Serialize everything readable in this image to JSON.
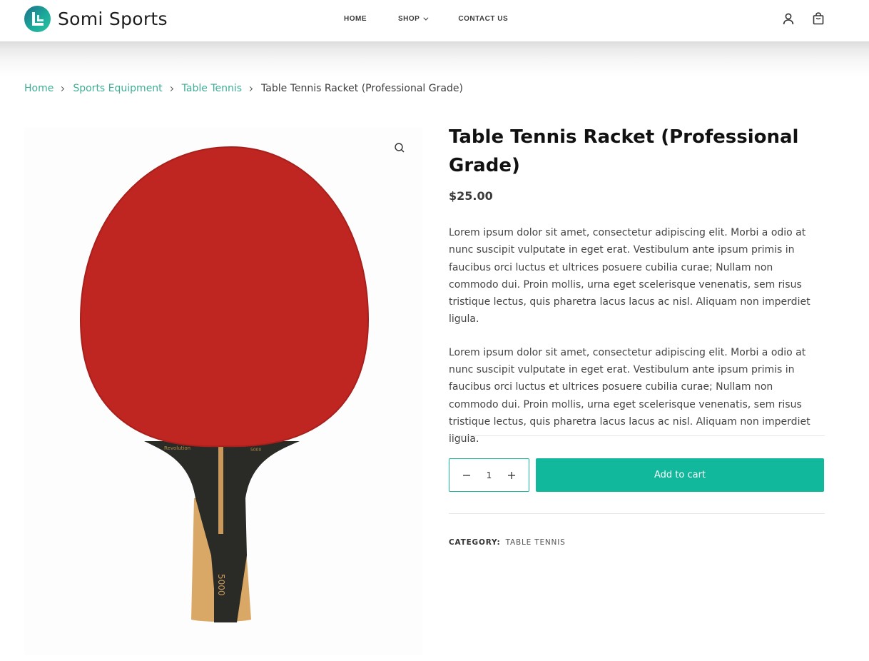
{
  "header": {
    "brand": "Somi Sports",
    "nav": [
      {
        "label": "HOME"
      },
      {
        "label": "SHOP"
      },
      {
        "label": "CONTACT US"
      }
    ],
    "icons": [
      "user-icon",
      "shopping-bag-icon"
    ]
  },
  "breadcrumb": {
    "items": [
      "Home",
      "Sports Equipment",
      "Table Tennis"
    ],
    "current": "Table Tennis Racket (Professional Grade)"
  },
  "product": {
    "image_text": {
      "brand": "Revolution",
      "model": "5000"
    },
    "title": "Table Tennis Racket (Professional Grade)",
    "price": "$25.00",
    "description": [
      "Lorem ipsum dolor sit amet, consectetur adipiscing elit. Morbi a odio at nunc suscipit vulputate in eget erat. Vestibulum ante ipsum primis in faucibus orci luctus et ultrices posuere cubilia curae; Nullam non commodo dui. Proin mollis, urna eget scelerisque venenatis, sem risus tristique lectus, quis pharetra lacus lacus ac nisl. Aliquam non imperdiet ligula.",
      "Lorem ipsum dolor sit amet, consectetur adipiscing elit. Morbi a odio at nunc suscipit vulputate in eget erat. Vestibulum ante ipsum primis in faucibus orci luctus et ultrices posuere cubilia curae; Nullam non commodo dui. Proin mollis, urna eget scelerisque venenatis, sem risus tristique lectus, quis pharetra lacus lacus ac nisl. Aliquam non imperdiet ligula."
    ],
    "quantity": "1",
    "add_to_cart": "Add to cart",
    "category_label": "CATEGORY:",
    "category": "TABLE TENNIS"
  },
  "colors": {
    "accent": "#12b89b",
    "link": "#3fae94",
    "racket_red": "#bf2521",
    "handle_dark": "#2a2a26",
    "handle_wood": "#d9a866"
  }
}
